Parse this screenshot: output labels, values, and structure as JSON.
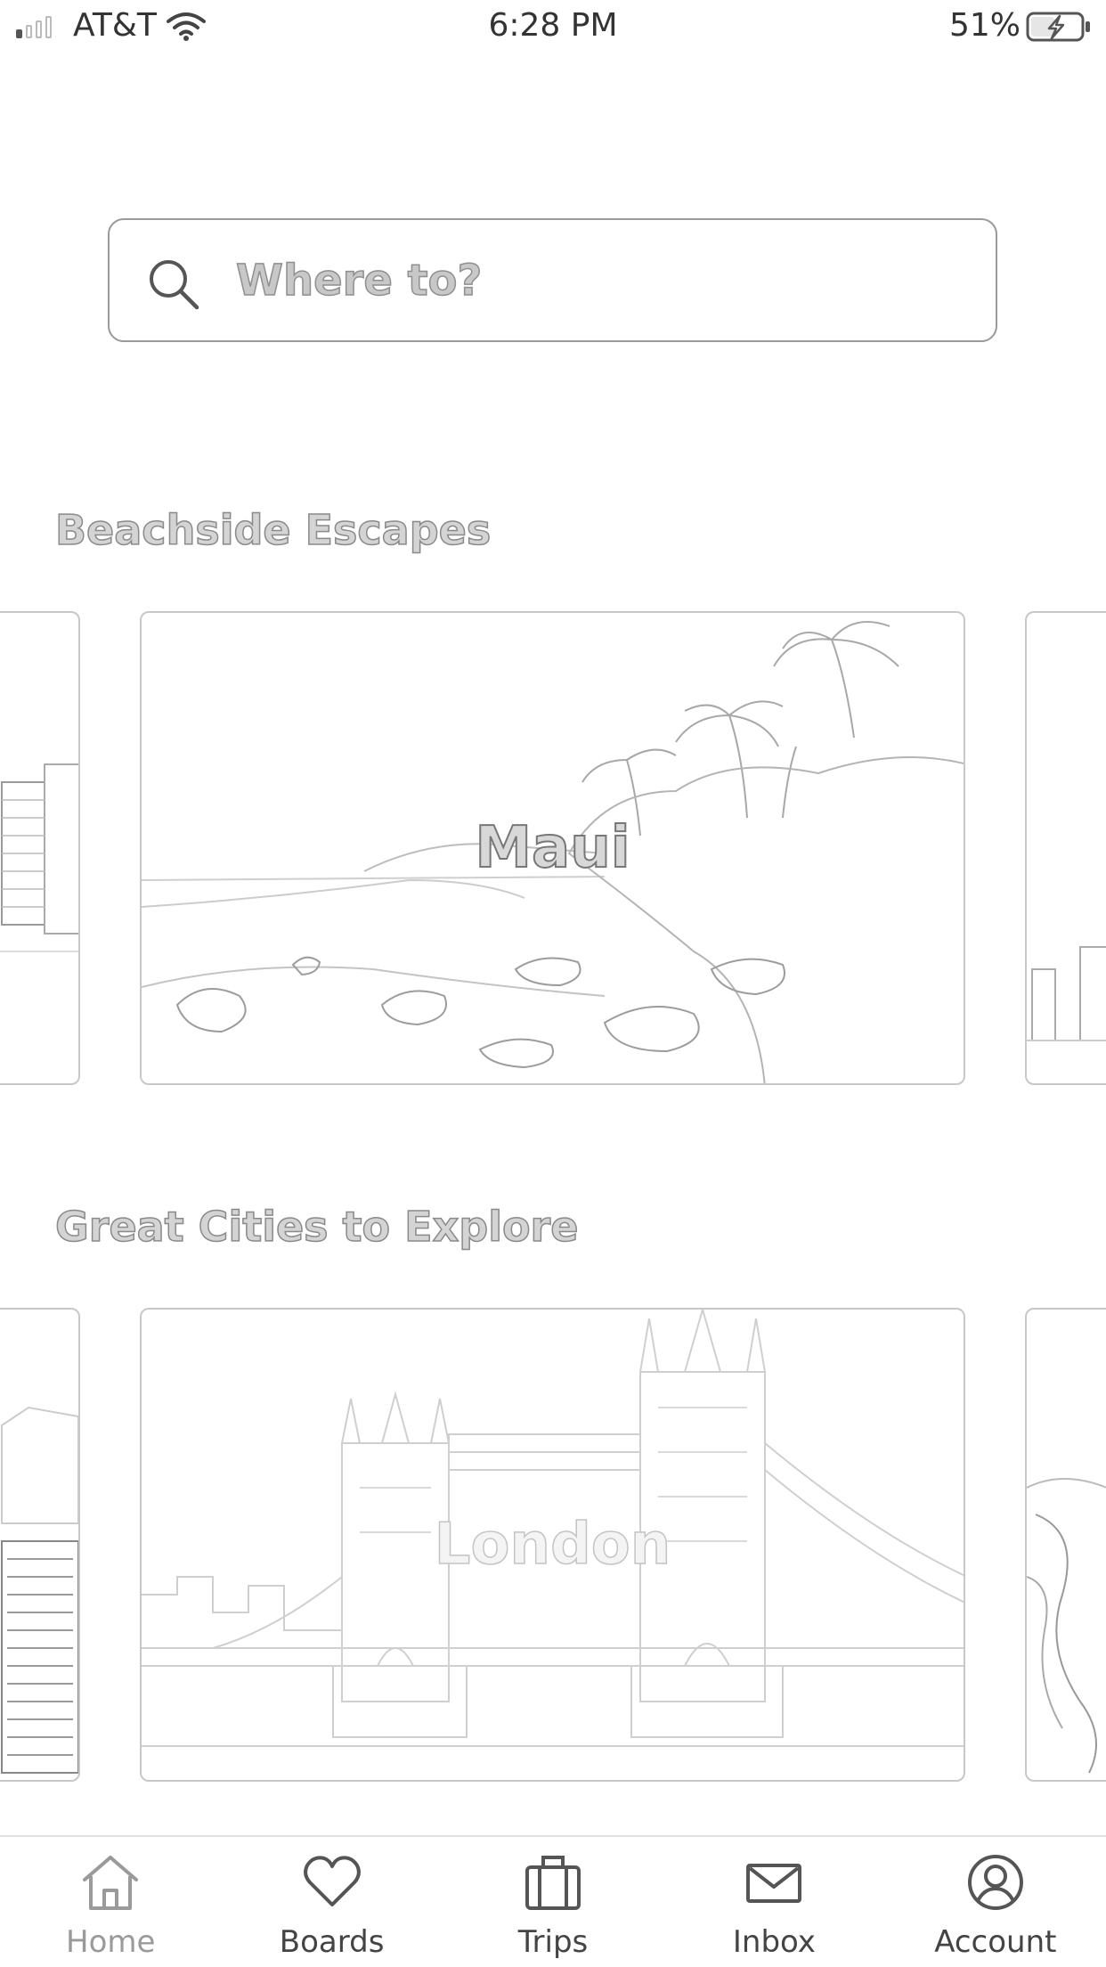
{
  "status_bar": {
    "carrier": "AT&T",
    "time": "6:28 PM",
    "battery": "51%",
    "icons": [
      "signal-icon",
      "wifi-icon",
      "battery-charging-icon"
    ]
  },
  "search": {
    "placeholder": "Where to?",
    "icon": "search-icon"
  },
  "sections": [
    {
      "title": "Beachside Escapes",
      "cards": [
        "",
        "Maui",
        ""
      ]
    },
    {
      "title": "Great Cities to Explore",
      "cards": [
        "",
        "London",
        ""
      ]
    }
  ],
  "tab_bar": {
    "active": "Home",
    "tabs": [
      {
        "label": "Home",
        "icon": "home-icon"
      },
      {
        "label": "Boards",
        "icon": "heart-icon"
      },
      {
        "label": "Trips",
        "icon": "suitcase-icon"
      },
      {
        "label": "Inbox",
        "icon": "envelope-icon"
      },
      {
        "label": "Account",
        "icon": "user-icon"
      }
    ]
  }
}
